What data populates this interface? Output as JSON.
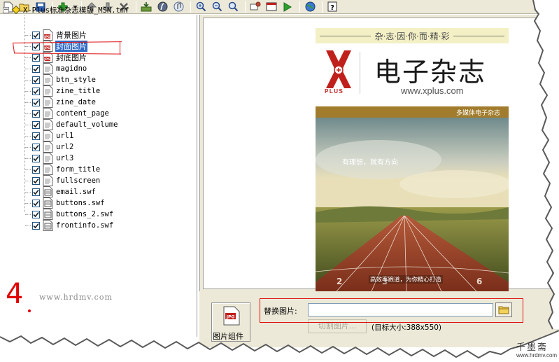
{
  "toolbar": {
    "buttons": [
      "new-icon",
      "open-icon",
      "save-icon",
      "add-icon",
      "dropdown-arrow-icon",
      "move-up-icon",
      "move-down-icon",
      "delete-icon",
      "import-icon",
      "flash-icon",
      "music-icon",
      "zoom-in-icon",
      "zoom-out-icon",
      "zoom-fit-icon",
      "settings-icon",
      "preview-window-icon",
      "play-icon",
      "globe-icon",
      "help-icon"
    ]
  },
  "tree": {
    "root_label": "X-Plus标准杂志模版_MSN.tmf",
    "root_expander": "−",
    "items": [
      {
        "label": "背景图片",
        "icon": "jpg-file-icon",
        "cn": true,
        "selected": false
      },
      {
        "label": "封面图片",
        "icon": "jpg-file-icon",
        "cn": true,
        "selected": true
      },
      {
        "label": "封底图片",
        "icon": "jpg-file-icon",
        "cn": true,
        "selected": false
      },
      {
        "label": "magidno",
        "icon": "text-file-icon",
        "cn": false,
        "selected": false
      },
      {
        "label": "btn_style",
        "icon": "text-file-icon",
        "cn": false,
        "selected": false
      },
      {
        "label": "zine_title",
        "icon": "text-file-icon",
        "cn": false,
        "selected": false
      },
      {
        "label": "zine_date",
        "icon": "text-file-icon",
        "cn": false,
        "selected": false
      },
      {
        "label": "content_page",
        "icon": "text-file-icon",
        "cn": false,
        "selected": false
      },
      {
        "label": "default_volume",
        "icon": "text-file-icon",
        "cn": false,
        "selected": false
      },
      {
        "label": "url1",
        "icon": "text-file-icon",
        "cn": false,
        "selected": false
      },
      {
        "label": "url2",
        "icon": "text-file-icon",
        "cn": false,
        "selected": false
      },
      {
        "label": "url3",
        "icon": "text-file-icon",
        "cn": false,
        "selected": false
      },
      {
        "label": "form_title",
        "icon": "text-file-icon",
        "cn": false,
        "selected": false
      },
      {
        "label": "fullscreen",
        "icon": "text-file-icon",
        "cn": false,
        "selected": false
      },
      {
        "label": "email.swf",
        "icon": "swf-file-icon",
        "cn": false,
        "selected": false
      },
      {
        "label": "buttons.swf",
        "icon": "swf-file-icon",
        "cn": false,
        "selected": false
      },
      {
        "label": "buttons_2.swf",
        "icon": "swf-file-icon",
        "cn": false,
        "selected": false
      },
      {
        "label": "frontinfo.swf",
        "icon": "swf-file-icon",
        "cn": false,
        "selected": false
      }
    ]
  },
  "annotation": {
    "step_number": "4",
    "watermark_url": "www.hrdmv.com"
  },
  "preview": {
    "slogan": "杂·志·因·你·而·精·彩",
    "logo_letter": "X",
    "logo_sub": "PLUS",
    "title": "电子杂志",
    "url": "www.xplus.com",
    "band_text": "多媒体电子杂志",
    "photo_caption": "有理想，就有方向",
    "track_text": "高效率跑道，为你精心打造"
  },
  "properties": {
    "component_icon_text": "JPG",
    "component_label": "图片组件",
    "replace_label": "替换图片:",
    "replace_value": "",
    "cut_button": "切割图片...",
    "target_size": "(目标大小:388x550)"
  },
  "brand": {
    "name": "千墨斋",
    "url": "www.hrdmv.com"
  },
  "colors": {
    "selection": "#316ac5",
    "annotation_red": "#e01010",
    "band": "#a17c2c",
    "logo_red": "#c0201c"
  }
}
